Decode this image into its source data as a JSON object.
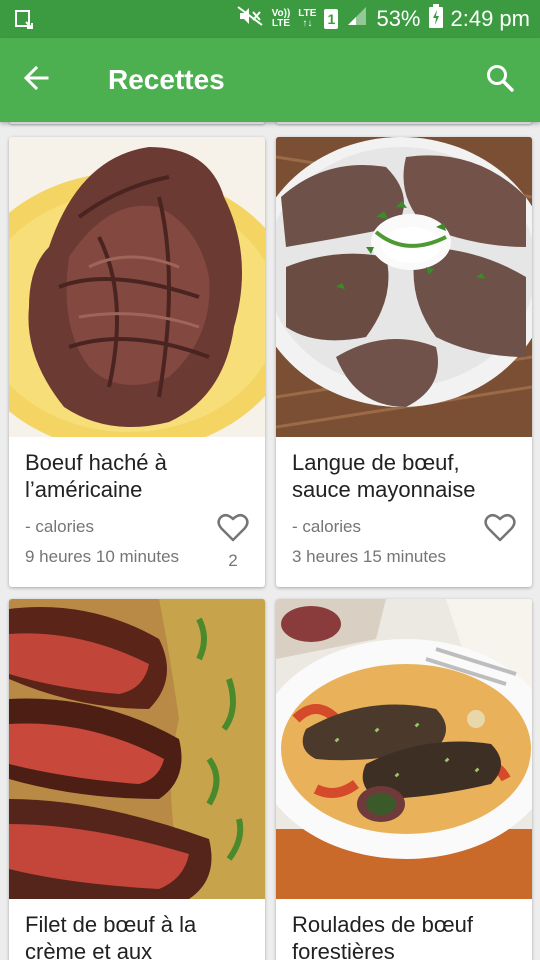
{
  "status_bar": {
    "volte_top": "Vo))",
    "volte_bottom": "LTE",
    "lte_top": "LTE",
    "lte_bottom": "↑↓",
    "sim": "1",
    "battery": "53%",
    "time": "2:49 pm",
    "icons": [
      "screenshot-icon",
      "mute-icon",
      "volte-icon",
      "lte-icon",
      "sim-icon",
      "signal-icon",
      "battery-charging-icon"
    ]
  },
  "app_bar": {
    "title": "Recettes",
    "icons": [
      "back-arrow-icon",
      "search-icon"
    ]
  },
  "colors": {
    "status_bar": "#3c9b41",
    "app_bar": "#4caf50",
    "background": "#ededed"
  },
  "recipes": [
    {
      "title": "Boeuf haché à l’américaine",
      "calories": "- calories",
      "duration": "9 heures 10 minutes",
      "favorites": "2",
      "image": "pulled-beef-photo"
    },
    {
      "title": "Langue de bœuf, sauce mayonnaise",
      "calories": "- calories",
      "duration": "3 heures 15 minutes",
      "favorites": "",
      "image": "beef-tongue-photo"
    },
    {
      "title": "Filet de bœuf à la crème et aux",
      "image": "beef-fillet-photo"
    },
    {
      "title": "Roulades de bœuf forestières",
      "image": "beef-roulades-photo"
    }
  ]
}
